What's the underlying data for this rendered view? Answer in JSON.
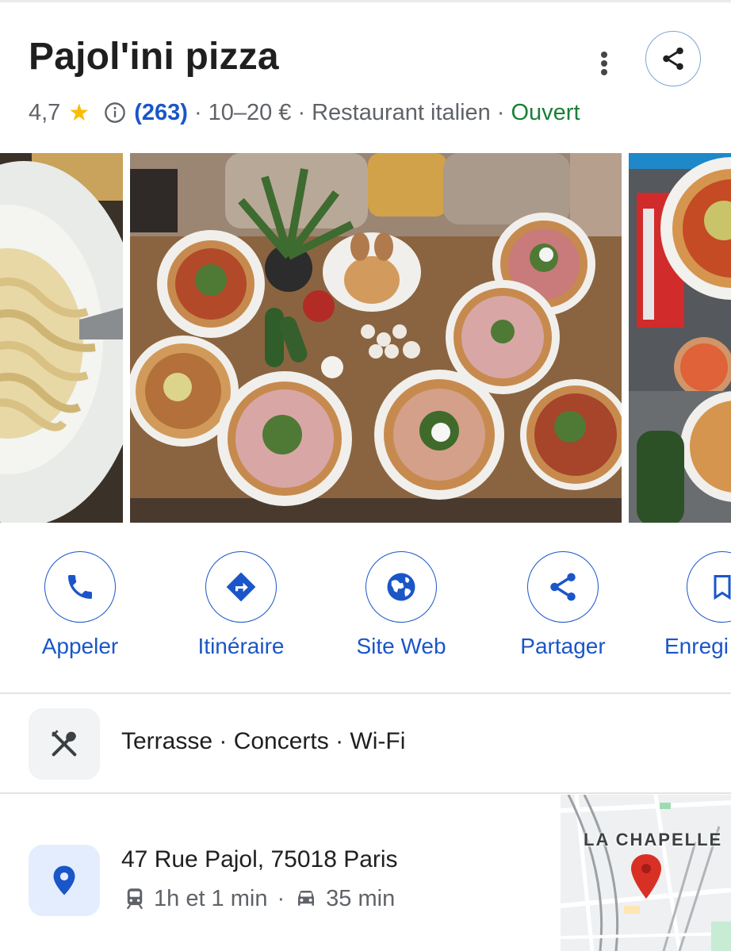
{
  "header": {
    "title": "Pajol'ini pizza",
    "rating": "4,7",
    "star_glyph": "★",
    "review_count": "(263)",
    "price_range": "10–20 €",
    "category": "Restaurant italien",
    "status": "Ouvert",
    "separator": "·"
  },
  "actions": [
    {
      "label": "Appeler",
      "icon": "phone-icon"
    },
    {
      "label": "Itinéraire",
      "icon": "directions-icon"
    },
    {
      "label": "Site Web",
      "icon": "globe-icon"
    },
    {
      "label": "Partager",
      "icon": "share-icon"
    },
    {
      "label": "Enregi",
      "icon": "bookmark-icon"
    }
  ],
  "amenities": {
    "text": "Terrasse · Concerts · Wi-Fi",
    "icon": "restaurant-icon"
  },
  "address": {
    "text": "47 Rue Pajol, 75018 Paris",
    "transit_time": "1h et 1 min",
    "drive_time": "35 min",
    "separator": "·",
    "icon": "location-pin-icon"
  },
  "map": {
    "label": "LA CHAPELLE"
  },
  "colors": {
    "accent_blue": "#1a56c8",
    "open_green": "#188038",
    "star_yellow": "#fbbc04",
    "pin_red": "#d93025"
  }
}
